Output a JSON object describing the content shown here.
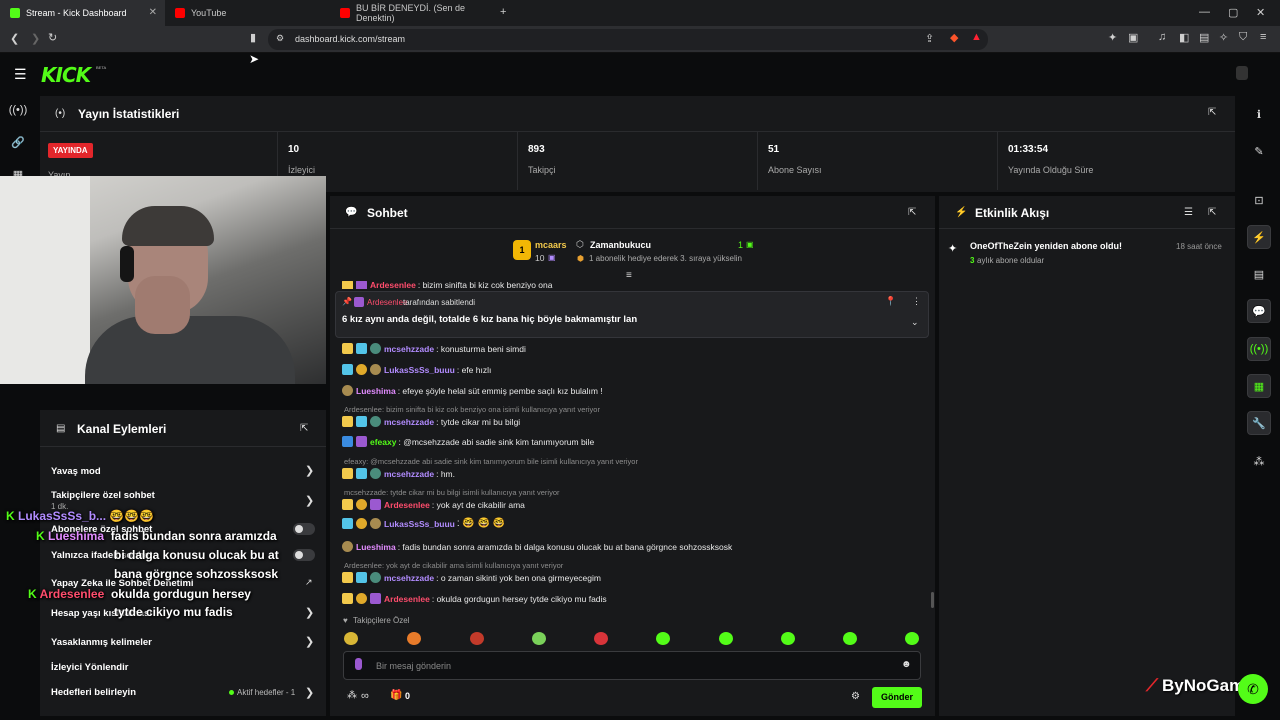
{
  "browser": {
    "tabs": [
      {
        "label": "Stream - Kick Dashboard",
        "active": true,
        "favicon_color": "#53fc18"
      },
      {
        "label": "YouTube",
        "active": false,
        "favicon_color": "#ff0000"
      },
      {
        "label": "BU BİR DENEYDİ. (Sen de Denektin)",
        "active": false,
        "favicon_color": "#ff0000"
      }
    ],
    "url": "dashboard.kick.com/stream"
  },
  "kick": {
    "logo": "KICK",
    "beta": "BETA"
  },
  "stats": {
    "title": "Yayın İstatistikleri",
    "live_badge": "YAYINDA",
    "live_label": "Yayın",
    "items": [
      {
        "value": "10",
        "label": "İzleyici"
      },
      {
        "value": "893",
        "label": "Takipçi"
      },
      {
        "value": "51",
        "label": "Abone Sayısı"
      },
      {
        "value": "01:33:54",
        "label": "Yayında Olduğu Süre"
      }
    ]
  },
  "chat": {
    "title": "Sohbet",
    "leader": {
      "name": "mcaars",
      "count": "10",
      "rank": "1"
    },
    "gifter": {
      "name": "Zamanbukucu",
      "count": "1",
      "note": "1 abonelik hediye ederek 3. sıraya yükselin"
    },
    "pinned": {
      "by": "Ardesenlee",
      "by_suffix": "tarafından sabitlendi",
      "text": "6 kız aynı anda değil, totalde 6 kız bana hiç böyle bakmamıştır lan"
    },
    "cut_line": {
      "user": "Ardesenlee",
      "text": ": bizim sinifta bi kiz cok benziyo ona"
    },
    "messages": [
      {
        "user": "mcsehzzade",
        "color": "#b28cff",
        "text": ": konusturma beni simdi"
      },
      {
        "user": "LukasSsSs_buuu",
        "color": "#b28cff",
        "text": ": efe hızlı"
      },
      {
        "user": "Lueshima",
        "color": "#e28cff",
        "text": ": efeye şöyle helal süt emmiş pembe saçlı kız bulalım !"
      },
      {
        "reply": "Ardesenlee: bizim sinifta bi kiz cok benziyo ona isimli kullanıcıya yanıt veriyor"
      },
      {
        "user": "mcsehzzade",
        "color": "#b28cff",
        "text": ": tytde cikar mi bu bilgi"
      },
      {
        "user": "efeaxy",
        "color": "#53fc18",
        "text": ": @mcsehzzade abi sadie sink kim tanımıyorum bile"
      },
      {
        "reply": "efeaxy: @mcsehzzade abi sadie sink kim tanımıyorum bile isimli kullanıcıya yanıt veriyor"
      },
      {
        "user": "mcsehzzade",
        "color": "#b28cff",
        "text": ": hm."
      },
      {
        "reply": "mcsehzzade: tytde cikar mi bu bilgi isimli kullanıcıya yanıt veriyor"
      },
      {
        "user": "Ardesenlee",
        "color": "#ff4d6d",
        "text": ": yok ayt de cikabilir ama"
      },
      {
        "user": "LukasSsSs_buuu",
        "color": "#b28cff",
        "text": ": 🤓 🤓 🤓"
      },
      {
        "user": "Lueshima",
        "color": "#e28cff",
        "text": ": fadis bundan sonra aramızda bi dalga konusu olucak bu at bana görgnce sohzossksosk"
      },
      {
        "reply": "Ardesenlee: yok ayt de cikabilir ama isimli kullanıcıya yanıt veriyor"
      },
      {
        "user": "mcsehzzade",
        "color": "#b28cff",
        "text": ": o zaman sikinti yok ben ona girmeyecegim"
      },
      {
        "user": "Ardesenlee",
        "color": "#ff4d6d",
        "text": ": okulda gordugun hersey tytde cikiyo mu fadis"
      }
    ],
    "followers_only": "Takipçilere Özel",
    "input_placeholder": "Bir mesaj gönderin",
    "send": "Gönder",
    "infinity": "∞",
    "zero": "0"
  },
  "activity": {
    "title": "Etkinlik Akışı",
    "items": [
      {
        "text": "OneOfTheZein yeniden abone oldu!",
        "months": "3",
        "sub": "aylık abone oldular",
        "time": "18 saat önce"
      }
    ]
  },
  "actions": {
    "title": "Kanal Eylemleri",
    "items": [
      {
        "label": "Yavaş mod"
      },
      {
        "label": "Takipçilere özel sohbet",
        "sub": "1 dk."
      },
      {
        "label": "Abonelere özel sohbet"
      },
      {
        "label": "Yalnızca ifadeli sohbet"
      },
      {
        "label": "Yapay Zeka ile Sohbet Denetimi"
      },
      {
        "label": "Hesap yaşı kısıtlaması"
      },
      {
        "label": "Yasaklanmış kelimeler"
      },
      {
        "label": "İzleyici Yönlendir"
      },
      {
        "label": "Hedefleri belirleyin",
        "status": "Aktif hedefler - 1"
      }
    ]
  },
  "overlay": {
    "lines": [
      {
        "user": "LukasSsSs_b...",
        "text": "🤓🤓🤓"
      },
      {
        "user": "Lueshima",
        "text": "fadis bundan sonra aramızda"
      },
      {
        "text": "bi dalga konusu olucak bu at"
      },
      {
        "text": "bana görgnce sohzossksosk"
      },
      {
        "user": "Ardesenlee",
        "text": "okulda gordugun hersey"
      },
      {
        "text": "tytde cikiyo mu fadis"
      }
    ],
    "watermark": "ByNoGame"
  }
}
